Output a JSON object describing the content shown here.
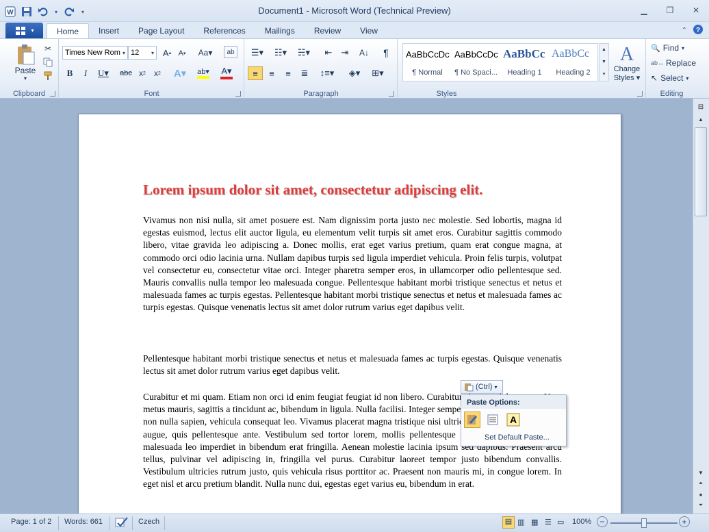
{
  "window": {
    "title": "Document1 - Microsoft Word (Technical Preview)",
    "controls": [
      "minimize",
      "restore",
      "close"
    ]
  },
  "tabs": [
    {
      "label": "Home",
      "active": true
    },
    {
      "label": "Insert"
    },
    {
      "label": "Page Layout"
    },
    {
      "label": "References"
    },
    {
      "label": "Mailings"
    },
    {
      "label": "Review"
    },
    {
      "label": "View"
    }
  ],
  "ribbon": {
    "clipboard": {
      "label": "Clipboard",
      "paste": "Paste"
    },
    "font": {
      "label": "Font",
      "name": "Times New Rom",
      "size": "12"
    },
    "paragraph": {
      "label": "Paragraph"
    },
    "styles": {
      "label": "Styles",
      "items": [
        {
          "sample": "AaBbCcDc",
          "name": "¶ Normal"
        },
        {
          "sample": "AaBbCcDc",
          "name": "¶ No Spaci..."
        },
        {
          "sample": "AaBbCc",
          "name": "Heading 1"
        },
        {
          "sample": "AaBbCc",
          "name": "Heading 2"
        }
      ],
      "change": "Change",
      "styles_word": "Styles"
    },
    "editing": {
      "label": "Editing",
      "find": "Find",
      "replace": "Replace",
      "select": "Select"
    }
  },
  "document": {
    "title": "Lorem ipsum dolor sit amet, consectetur adipiscing elit.",
    "paragraphs": [
      "Vivamus non nisi nulla, sit amet posuere est. Nam dignissim porta justo nec molestie. Sed lobortis, magna id egestas euismod, lectus elit auctor ligula, eu elementum velit turpis sit amet eros. Curabitur sagittis commodo libero, vitae gravida leo adipiscing a. Donec mollis, erat eget varius pretium, quam erat congue magna, at commodo orci odio lacinia urna. Nullam dapibus turpis sed ligula imperdiet vehicula. Proin felis turpis, volutpat vel consectetur eu, consectetur vitae orci. Integer pharetra semper eros, in ullamcorper odio pellentesque sed. Mauris convallis nulla tempor leo malesuada congue. Pellentesque habitant morbi tristique senectus et netus et malesuada fames ac turpis egestas. Pellentesque habitant morbi tristique senectus et netus et malesuada fames ac turpis egestas. Quisque venenatis lectus sit amet dolor rutrum varius eget dapibus velit.",
      "Pellentesque habitant morbi tristique senectus et netus et malesuada fames ac turpis egestas. Quisque venenatis lectus sit amet dolor rutrum varius eget dapibus velit.",
      "Curabitur et mi quam. Etiam non orci id enim feugiat feugiat id non libero. Curabitur sit amet dolor tortor. Nam metus mauris, sagittis a tincidunt ac, bibendum in ligula. Nulla facilisi. Integer semper scelerisque mollis. Donec non nulla sapien, vehicula consequat leo. Vivamus placerat magna tristique nisi ultricies varius. Nulla in magna augue, quis pellentesque ante. Vestibulum sed tortor lorem, mollis pellentesque dolor. Nam egestas neque malesuada leo imperdiet in bibendum erat fringilla. Aenean molestie lacinia ipsum sed dapibus. Praesent arcu tellus, pulvinar vel adipiscing in, fringilla vel purus. Curabitur laoreet tempor justo bibendum convallis. Vestibulum ultricies rutrum justo, quis vehicula risus porttitor ac. Praesent non mauris mi, in congue lorem. In eget nisl et arcu pretium blandit. Nulla nunc dui, egestas eget varius eu, bibendum in erat."
    ]
  },
  "paste_popup": {
    "ctrl_label": "(Ctrl)",
    "header": "Paste Options:",
    "set_default": "Set Default Paste..."
  },
  "statusbar": {
    "page": "Page: 1 of 2",
    "words": "Words: 661",
    "language": "Czech",
    "zoom": "100%",
    "zoom_fraction": 0.5
  },
  "colors": {
    "accent": "#1d4fa0",
    "title_red": "#e03a3a",
    "ribbon_text": "#1e395b"
  }
}
